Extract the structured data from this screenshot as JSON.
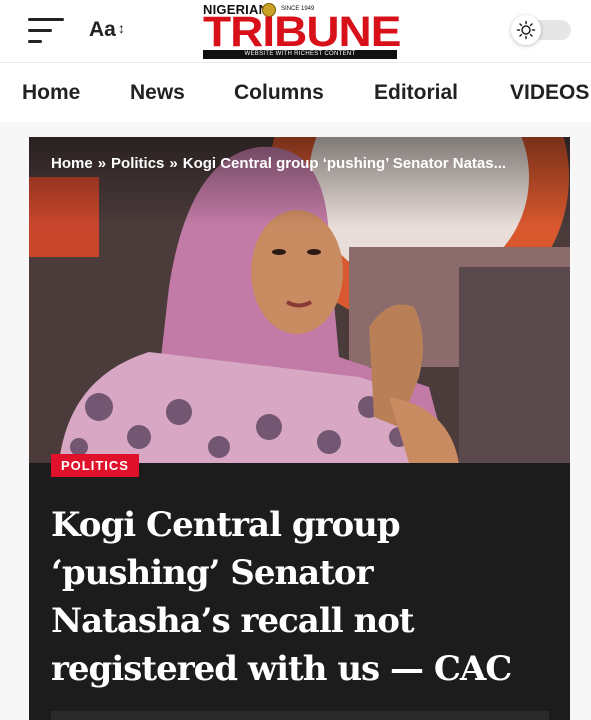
{
  "header": {
    "font_size_label": "Aa",
    "font_size_arrow": "↕",
    "logo": {
      "top_text": "NIGERIAN",
      "since_text": "SINCE 1949",
      "main_text": "TRIBUNE",
      "tagline": "WEBSITE WITH RICHEST CONTENT",
      "brand_color": "#d8101a"
    },
    "menu_icon": "hamburger-icon",
    "theme_icon": "sun-icon"
  },
  "nav": {
    "items": [
      {
        "label": "Home"
      },
      {
        "label": "News"
      },
      {
        "label": "Columns"
      },
      {
        "label": "Editorial"
      },
      {
        "label": "VIDEOS"
      }
    ]
  },
  "article": {
    "breadcrumb": {
      "home": "Home",
      "separator": "»",
      "section": "Politics",
      "current": "Kogi Central group ‘pushing’ Senator Natas..."
    },
    "category": "POLITICS",
    "category_color": "#e0112a",
    "headline_lines": [
      "Kogi Central group",
      "‘pushing’ Senator",
      "Natasha’s recall not",
      "registered with us — CAC"
    ]
  }
}
